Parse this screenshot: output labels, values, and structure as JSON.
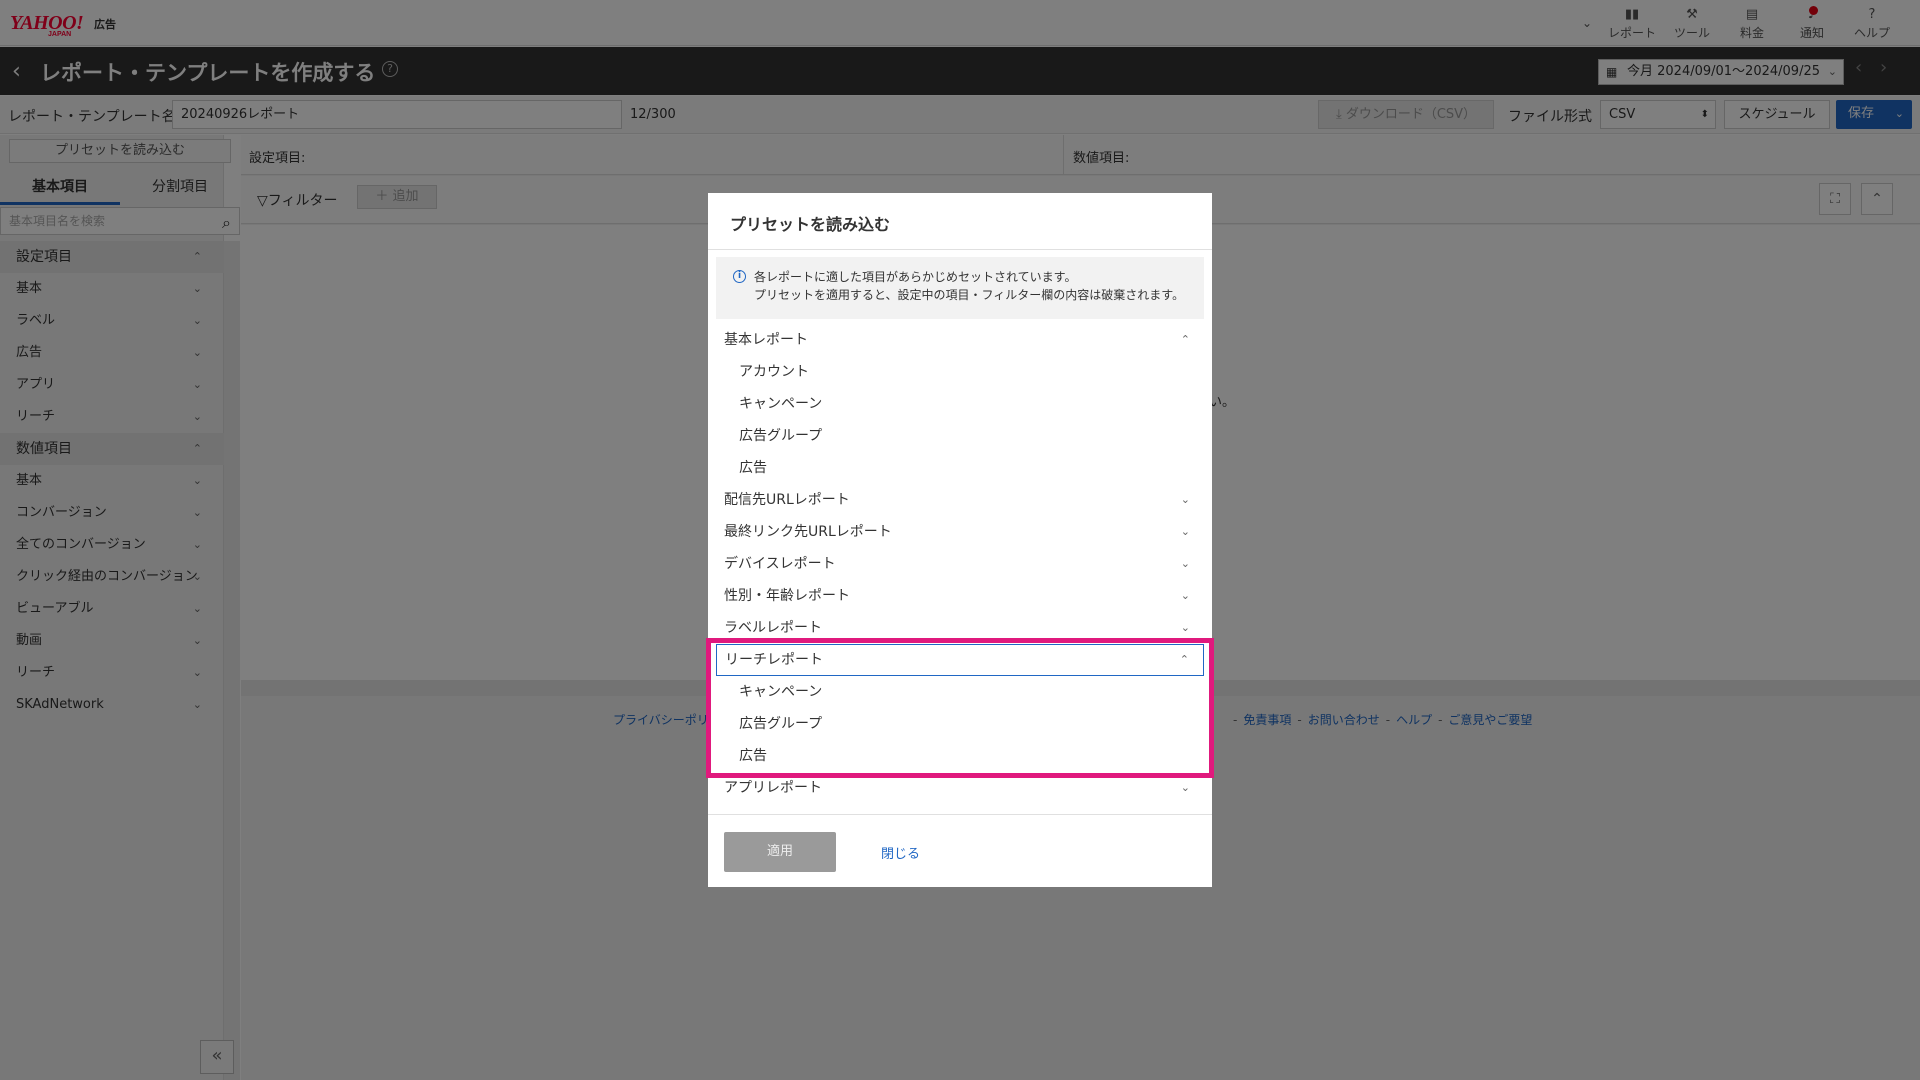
{
  "header": {
    "logo": "YAHOO!",
    "logo_sub": "JAPAN",
    "logo_ad": "広告",
    "nav": [
      {
        "label": "レポート",
        "icon": "bar-chart-icon"
      },
      {
        "label": "ツール",
        "icon": "wrench-icon"
      },
      {
        "label": "料金",
        "icon": "billing-icon"
      },
      {
        "label": "通知",
        "icon": "bell-icon"
      },
      {
        "label": "ヘルプ",
        "icon": "help-icon"
      }
    ]
  },
  "titlebar": {
    "title": "レポート・テンプレートを作成する",
    "date_range": "今月 2024/09/01～2024/09/25"
  },
  "namerow": {
    "label": "レポート・テンプレート名",
    "value": "20240926レポート",
    "counter": "12/300",
    "download": "ダウンロード（CSV）",
    "file_format_label": "ファイル形式",
    "file_format": "CSV",
    "schedule": "スケジュール",
    "save": "保存"
  },
  "sidebar": {
    "preset_button": "プリセットを読み込む",
    "tabs": [
      "基本項目",
      "分割項目"
    ],
    "search_placeholder": "基本項目名を検索",
    "items": [
      {
        "label": "設定項目",
        "head": true,
        "chev": "⌃"
      },
      {
        "label": "基本",
        "head": false,
        "chev": "⌄"
      },
      {
        "label": "ラベル",
        "head": false,
        "chev": "⌄"
      },
      {
        "label": "広告",
        "head": false,
        "chev": "⌄"
      },
      {
        "label": "アプリ",
        "head": false,
        "chev": "⌄"
      },
      {
        "label": "リーチ",
        "head": false,
        "chev": "⌄"
      },
      {
        "label": "数値項目",
        "head": true,
        "chev": "⌃"
      },
      {
        "label": "基本",
        "head": false,
        "chev": "⌄"
      },
      {
        "label": "コンバージョン",
        "head": false,
        "chev": "⌄"
      },
      {
        "label": "全てのコンバージョン",
        "head": false,
        "chev": "⌄"
      },
      {
        "label": "クリック経由のコンバージョン",
        "head": false,
        "chev": "⌄"
      },
      {
        "label": "ビューアブル",
        "head": false,
        "chev": "⌄"
      },
      {
        "label": "動画",
        "head": false,
        "chev": "⌄"
      },
      {
        "label": "リーチ",
        "head": false,
        "chev": "⌄"
      },
      {
        "label": "SKAdNetwork",
        "head": false,
        "chev": "⌄"
      }
    ]
  },
  "main": {
    "setting_label": "設定項目:",
    "numeric_label": "数値項目:",
    "filter_label": "▽フィルター",
    "add_label": "＋ 追加",
    "background_text": "い。",
    "footer_left": "プライバシーポリ",
    "footer_right": [
      "免責事項",
      "お問い合わせ",
      "ヘルプ",
      "ご意見やご要望"
    ]
  },
  "modal": {
    "title": "プリセットを読み込む",
    "info_line1": "各レポートに適した項目があらかじめセットされています。",
    "info_line2": "プリセットを適用すると、設定中の項目・フィルター欄の内容は破棄されます。",
    "list": [
      {
        "label": "基本レポート",
        "sub": false,
        "chev": "⌃"
      },
      {
        "label": "アカウント",
        "sub": true,
        "chev": ""
      },
      {
        "label": "キャンペーン",
        "sub": true,
        "chev": ""
      },
      {
        "label": "広告グループ",
        "sub": true,
        "chev": ""
      },
      {
        "label": "広告",
        "sub": true,
        "chev": ""
      },
      {
        "label": "配信先URLレポート",
        "sub": false,
        "chev": "⌄"
      },
      {
        "label": "最終リンク先URLレポート",
        "sub": false,
        "chev": "⌄"
      },
      {
        "label": "デバイスレポート",
        "sub": false,
        "chev": "⌄"
      },
      {
        "label": "性別・年齢レポート",
        "sub": false,
        "chev": "⌄"
      },
      {
        "label": "ラベルレポート",
        "sub": false,
        "chev": "⌄"
      },
      {
        "label": "リーチレポート",
        "sub": false,
        "chev": "⌃",
        "focused": true
      },
      {
        "label": "キャンペーン",
        "sub": true,
        "chev": ""
      },
      {
        "label": "広告グループ",
        "sub": true,
        "chev": ""
      },
      {
        "label": "広告",
        "sub": true,
        "chev": ""
      },
      {
        "label": "アプリレポート",
        "sub": false,
        "chev": "⌄"
      }
    ],
    "apply": "適用",
    "close": "閉じる"
  },
  "colors": {
    "accent": "#2067c4",
    "highlight": "#e0197d"
  }
}
